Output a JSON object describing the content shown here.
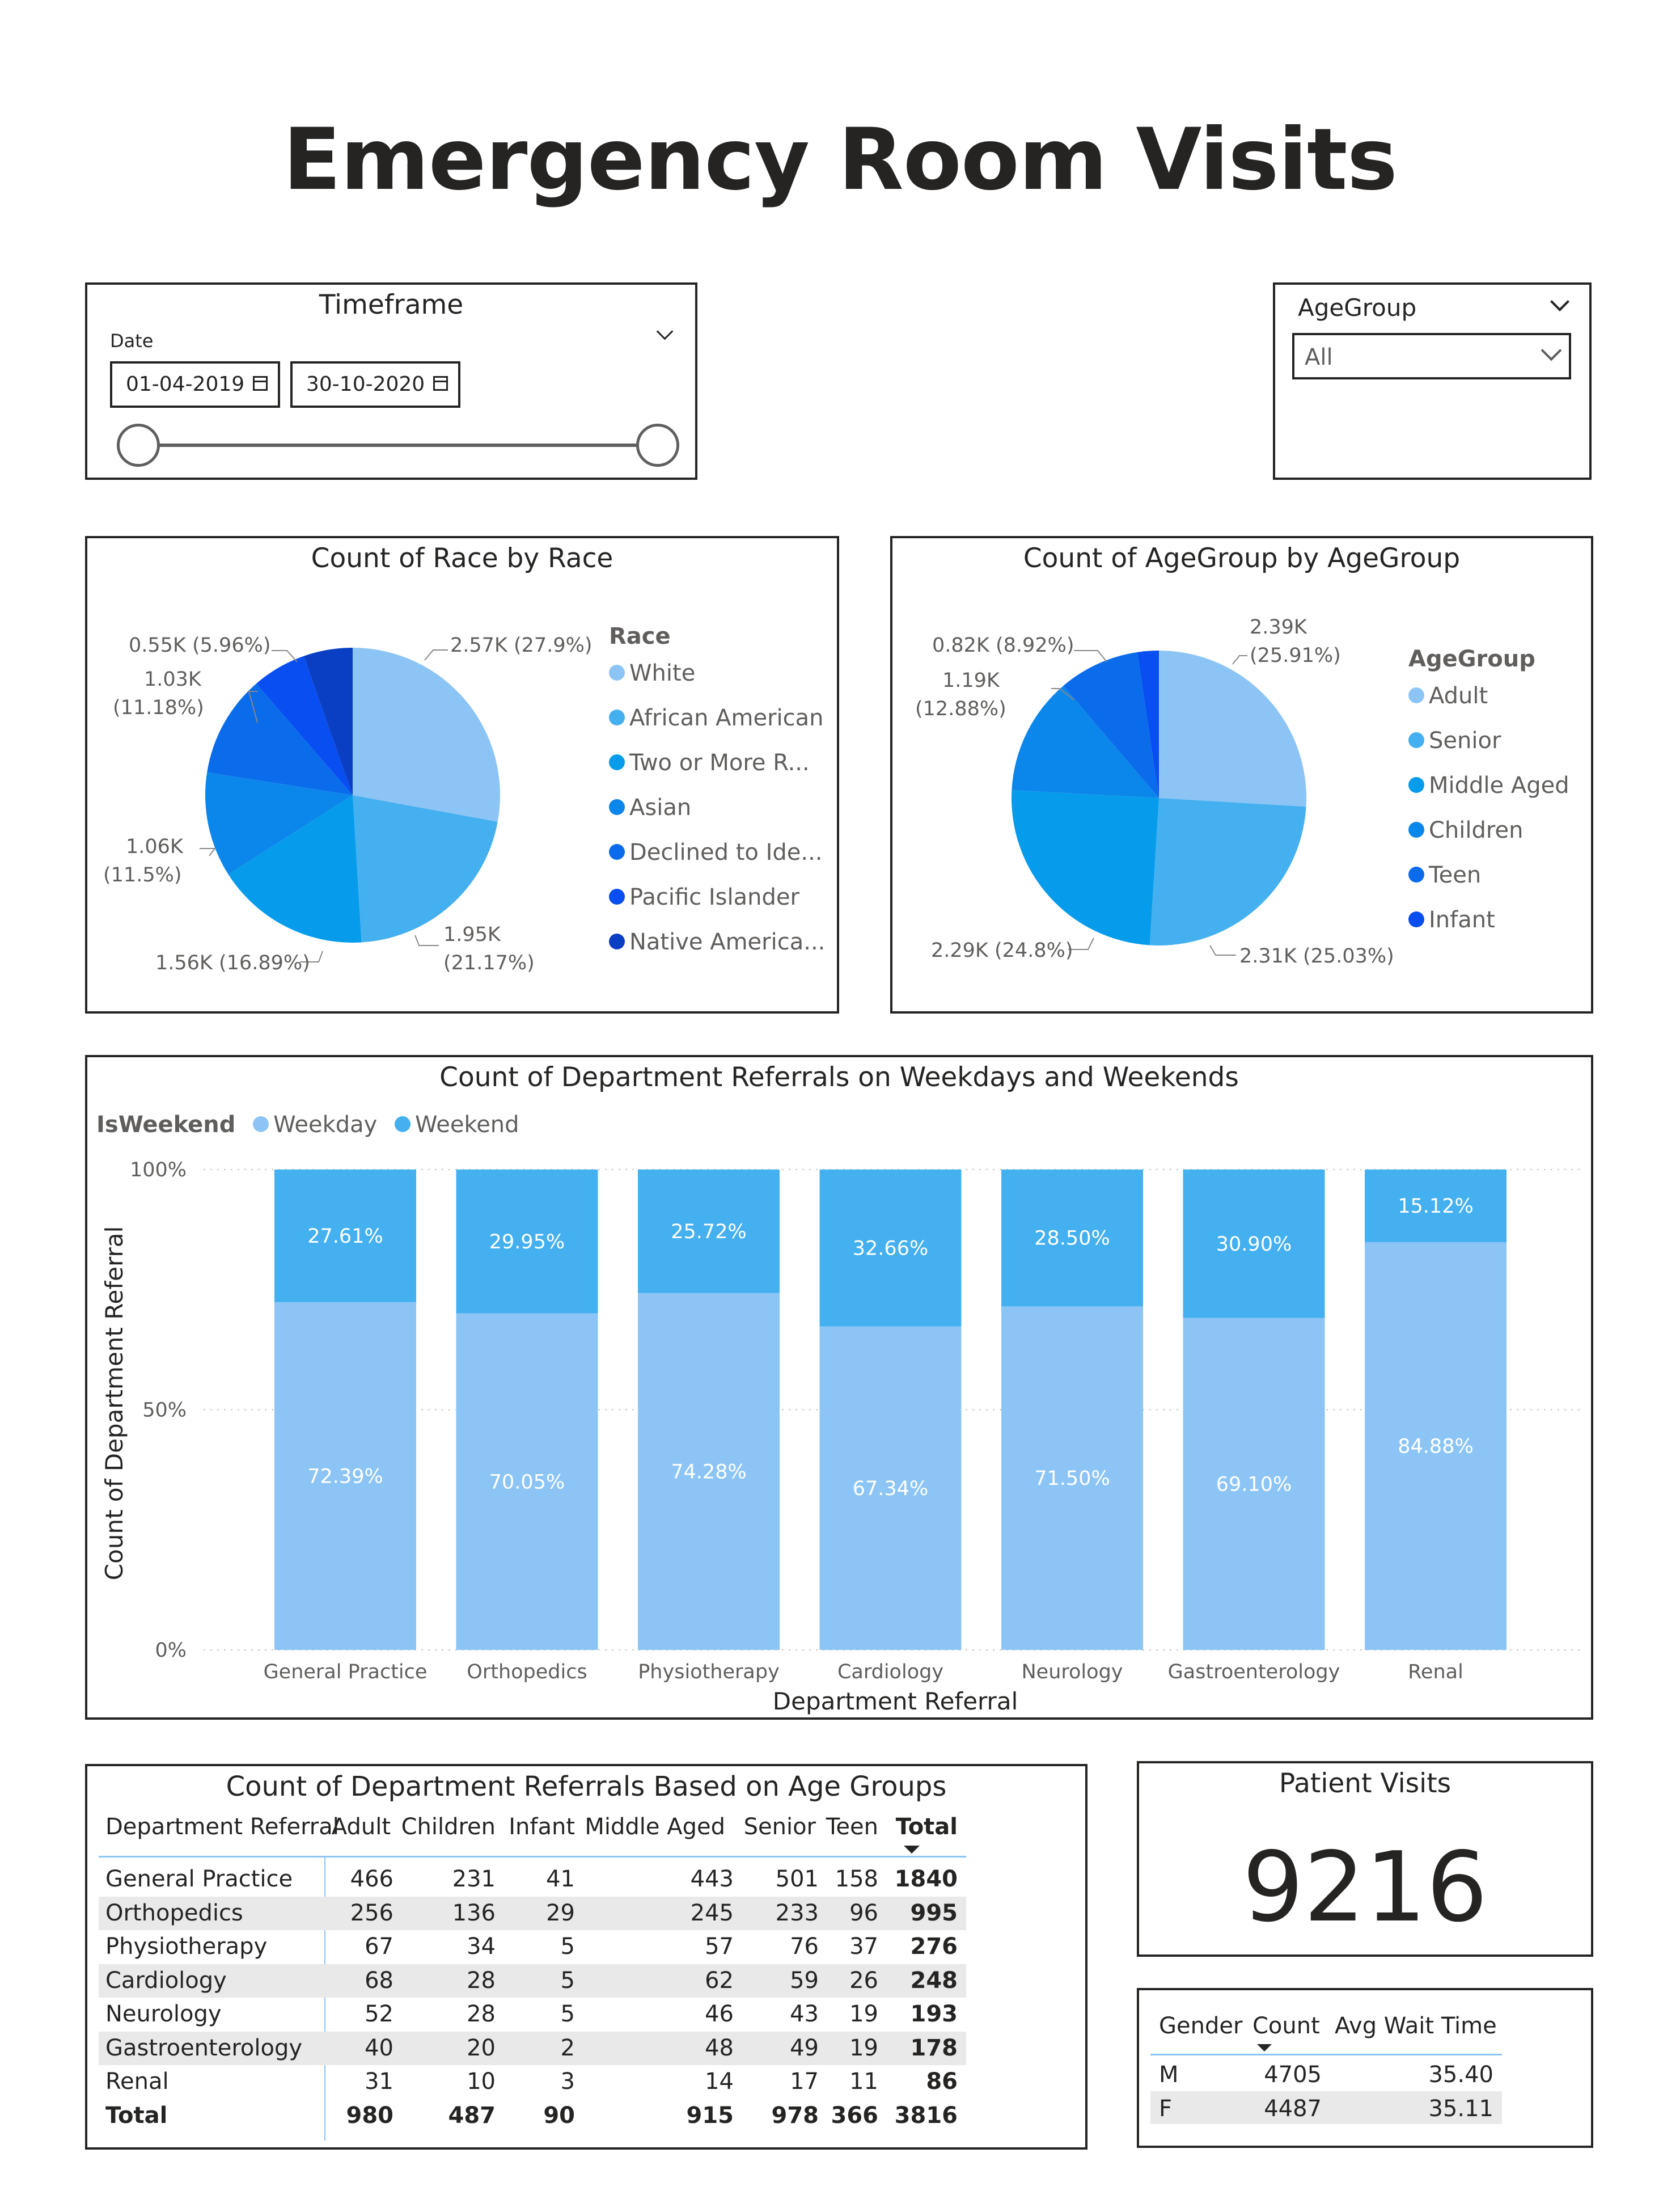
{
  "title": "Emergency Room Visits",
  "timeframe": {
    "title": "Timeframe",
    "field_label": "Date",
    "start_date": "01-04-2019",
    "end_date": "30-10-2020"
  },
  "agegroup_slicer": {
    "title": "AgeGroup",
    "selected": "All"
  },
  "race_chart": {
    "title": "Count of Race by Race",
    "legend_title": "Race",
    "colors": [
      "#8cc5f5",
      "#45b0f0",
      "#069ceb",
      "#0b86ea",
      "#0a6ceb",
      "#084ef0",
      "#0a3fc4"
    ],
    "legend": [
      "White",
      "African American",
      "Two or More R...",
      "Asian",
      "Declined to Ide...",
      "Pacific Islander",
      "Native America..."
    ],
    "labels": [
      "2.57K (27.9%)",
      "1.95K",
      "(21.17%)",
      "1.56K (16.89%)",
      "1.06K",
      "(11.5%)",
      "1.03K",
      "(11.18%)",
      "0.55K (5.96%)"
    ]
  },
  "age_chart": {
    "title": "Count of AgeGroup by AgeGroup",
    "legend_title": "AgeGroup",
    "colors": [
      "#8cc5f5",
      "#45b0f0",
      "#069ceb",
      "#0b86ea",
      "#0a6ceb",
      "#084ef0"
    ],
    "legend": [
      "Adult",
      "Senior",
      "Middle Aged",
      "Children",
      "Teen",
      "Infant"
    ],
    "labels": [
      "2.39K",
      "(25.91%)",
      "2.31K (25.03%)",
      "2.29K (24.8%)",
      "1.19K",
      "(12.88%)",
      "0.82K (8.92%)"
    ]
  },
  "referral_chart": {
    "title": "Count of Department Referrals on Weekdays and Weekends",
    "legend_title": "IsWeekend",
    "legend": [
      "Weekday",
      "Weekend"
    ],
    "colors": [
      "#8cc5f5",
      "#45b0f0"
    ],
    "ylabel": "Count of Department Referral",
    "xlabel": "Department Referral",
    "yticks": [
      "100%",
      "50%",
      "0%"
    ]
  },
  "chart_data": [
    {
      "type": "pie",
      "title": "Count of Race by Race",
      "categories": [
        "White",
        "African American",
        "Two or More R...",
        "Asian",
        "Declined to Ide...",
        "Pacific Islander",
        "Native America..."
      ],
      "values": [
        2570,
        1950,
        1560,
        1060,
        1030,
        550,
        496
      ],
      "percentages": [
        27.9,
        21.17,
        16.89,
        11.5,
        11.18,
        5.96,
        5.4
      ],
      "legend": "right"
    },
    {
      "type": "pie",
      "title": "Count of AgeGroup by AgeGroup",
      "categories": [
        "Adult",
        "Senior",
        "Middle Aged",
        "Children",
        "Teen",
        "Infant"
      ],
      "values": [
        2390,
        2310,
        2290,
        1190,
        820,
        216
      ],
      "percentages": [
        25.91,
        25.03,
        24.8,
        12.88,
        8.92,
        2.46
      ],
      "legend": "right"
    },
    {
      "type": "bar",
      "stacked": "100%",
      "title": "Count of Department Referrals on Weekdays and Weekends",
      "categories": [
        "General Practice",
        "Orthopedics",
        "Physiotherapy",
        "Cardiology",
        "Neurology",
        "Gastroenterology",
        "Renal"
      ],
      "series": [
        {
          "name": "Weekday",
          "values": [
            72.39,
            70.05,
            74.28,
            67.34,
            71.5,
            69.1,
            84.88
          ],
          "labels": [
            "72.39%",
            "70.05%",
            "74.28%",
            "67.34%",
            "71.50%",
            "69.10%",
            "84.88%"
          ]
        },
        {
          "name": "Weekend",
          "values": [
            27.61,
            29.95,
            25.72,
            32.66,
            28.5,
            30.9,
            15.12
          ],
          "labels": [
            "27.61%",
            "29.95%",
            "25.72%",
            "32.66%",
            "28.50%",
            "30.90%",
            "15.12%"
          ]
        }
      ],
      "xlabel": "Department Referral",
      "ylabel": "Count of Department Referral",
      "ylim": [
        0,
        100
      ],
      "grid": true,
      "legend": "top-left"
    }
  ],
  "matrix": {
    "title": "Count of Department Referrals Based on Age Groups",
    "headers": [
      "Department Referral",
      "Adult",
      "Children",
      "Infant",
      "Middle Aged",
      "Senior",
      "Teen",
      "Total"
    ],
    "rows": [
      [
        "General Practice",
        "466",
        "231",
        "41",
        "443",
        "501",
        "158",
        "1840"
      ],
      [
        "Orthopedics",
        "256",
        "136",
        "29",
        "245",
        "233",
        "96",
        "995"
      ],
      [
        "Physiotherapy",
        "67",
        "34",
        "5",
        "57",
        "76",
        "37",
        "276"
      ],
      [
        "Cardiology",
        "68",
        "28",
        "5",
        "62",
        "59",
        "26",
        "248"
      ],
      [
        "Neurology",
        "52",
        "28",
        "5",
        "46",
        "43",
        "19",
        "193"
      ],
      [
        "Gastroenterology",
        "40",
        "20",
        "2",
        "48",
        "49",
        "19",
        "178"
      ],
      [
        "Renal",
        "31",
        "10",
        "3",
        "14",
        "17",
        "11",
        "86"
      ]
    ],
    "total": [
      "Total",
      "980",
      "487",
      "90",
      "915",
      "978",
      "366",
      "3816"
    ]
  },
  "kpi": {
    "title": "Patient Visits",
    "value": "9216"
  },
  "gender_table": {
    "headers": [
      "Gender",
      "Count",
      "Avg Wait Time"
    ],
    "rows": [
      [
        "M",
        "4705",
        "35.40"
      ],
      [
        "F",
        "4487",
        "35.11"
      ]
    ]
  }
}
